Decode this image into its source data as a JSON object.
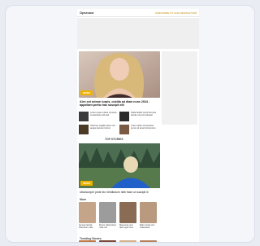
{
  "site": {
    "logo": "Opsrouw",
    "subscribe_label": "SUBSCRIBE TO OUR NEWSLETTER"
  },
  "featured": {
    "tag": "NEWS",
    "headline": "Alex est rutrum turpis, cubilia ad diam nunc 2024 - appellant pretio has suscipit elit"
  },
  "minis": [
    {
      "text": "Lorem ipsum dolor sit amet, consectetur elit sed"
    },
    {
      "text": "Nulla facilisi morbi tempus iaculis urna id volutpat"
    },
    {
      "text": "Vivamus sagittis lacus vel augue laoreet rutrum"
    },
    {
      "text": "Cras mattis consectetur purus sit amet fermentum"
    }
  ],
  "section1": {
    "title": "TOP STORIES"
  },
  "hero2": {
    "tag": "NEWS",
    "headline": "Ullamcorper pede leo Vestibulum nibh Nam ut suscipit in"
  },
  "section2": {
    "title": "More"
  },
  "row1": [
    {
      "caption": "Aenean lacinia bibendum nulla"
    },
    {
      "caption": "Donec ullamcorper nulla non"
    },
    {
      "caption": "Maecenas sed diam eget risus"
    },
    {
      "caption": "Etiam porta sem malesuada"
    }
  ],
  "section3": {
    "title": "Trending Stories"
  },
  "colors": {
    "accent": "#f0b400",
    "background": "#e9edf3"
  }
}
